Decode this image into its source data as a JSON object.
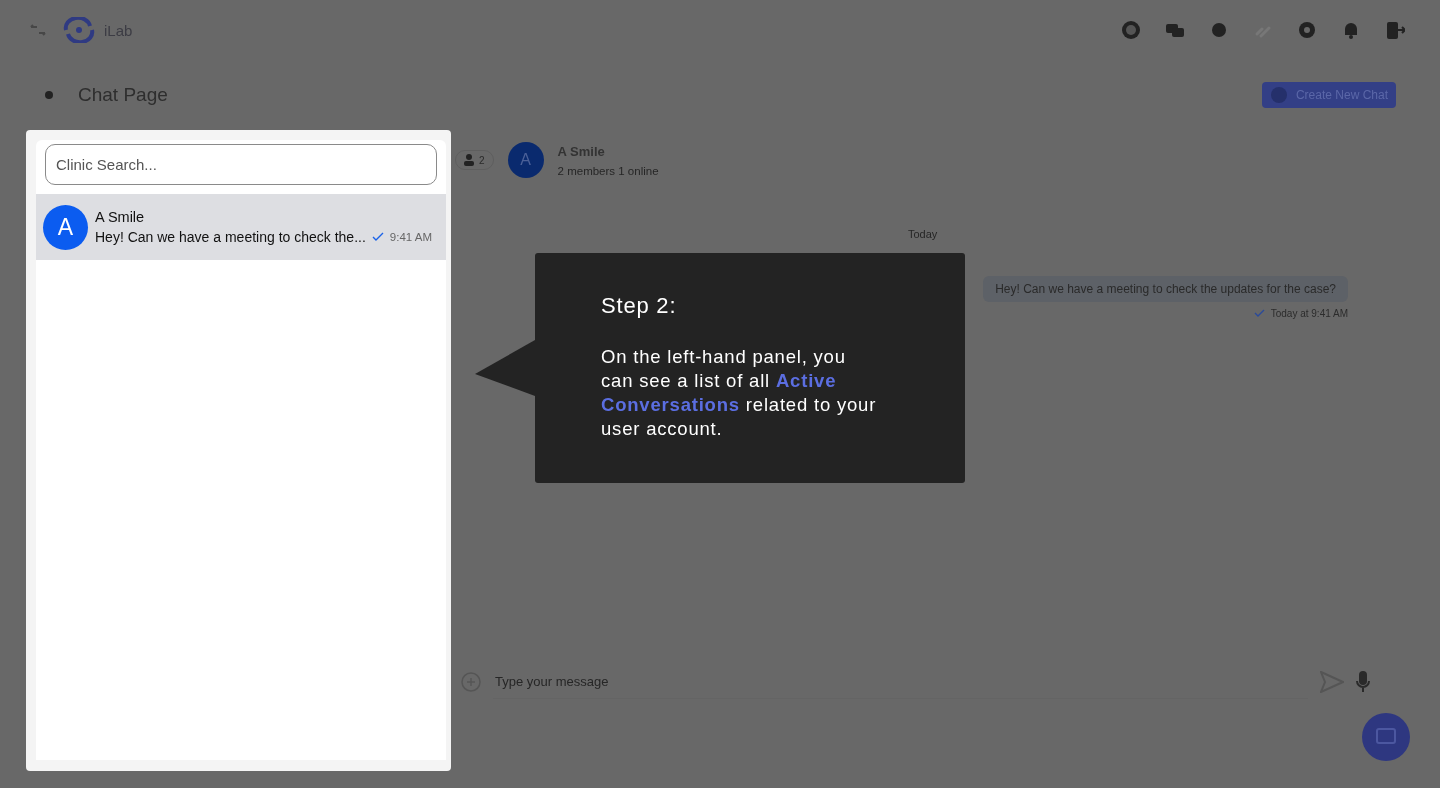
{
  "app": {
    "name": "iLab"
  },
  "page": {
    "title": "Chat Page",
    "create_button": "Create New Chat"
  },
  "search": {
    "placeholder": "Clinic Search..."
  },
  "conversations": [
    {
      "avatar": "A",
      "name": "A Smile",
      "preview": "Hey! Can we have a meeting to check the...",
      "time": "9:41 AM",
      "read": true,
      "selected": true
    }
  ],
  "chat": {
    "member_count": "2",
    "avatar": "A",
    "name": "A Smile",
    "status": "2 members 1 online",
    "date_divider": "Today",
    "messages": [
      {
        "text": "Hey! Can we have a meeting to check the updates for the case?",
        "time": "Today at 9:41 AM",
        "read": true
      }
    ],
    "input": {
      "placeholder": "Type your message"
    }
  },
  "tooltip": {
    "title": "Step 2:",
    "body": "On the left-hand panel, you can see a list of all **Active Conversations** related to your user account."
  }
}
